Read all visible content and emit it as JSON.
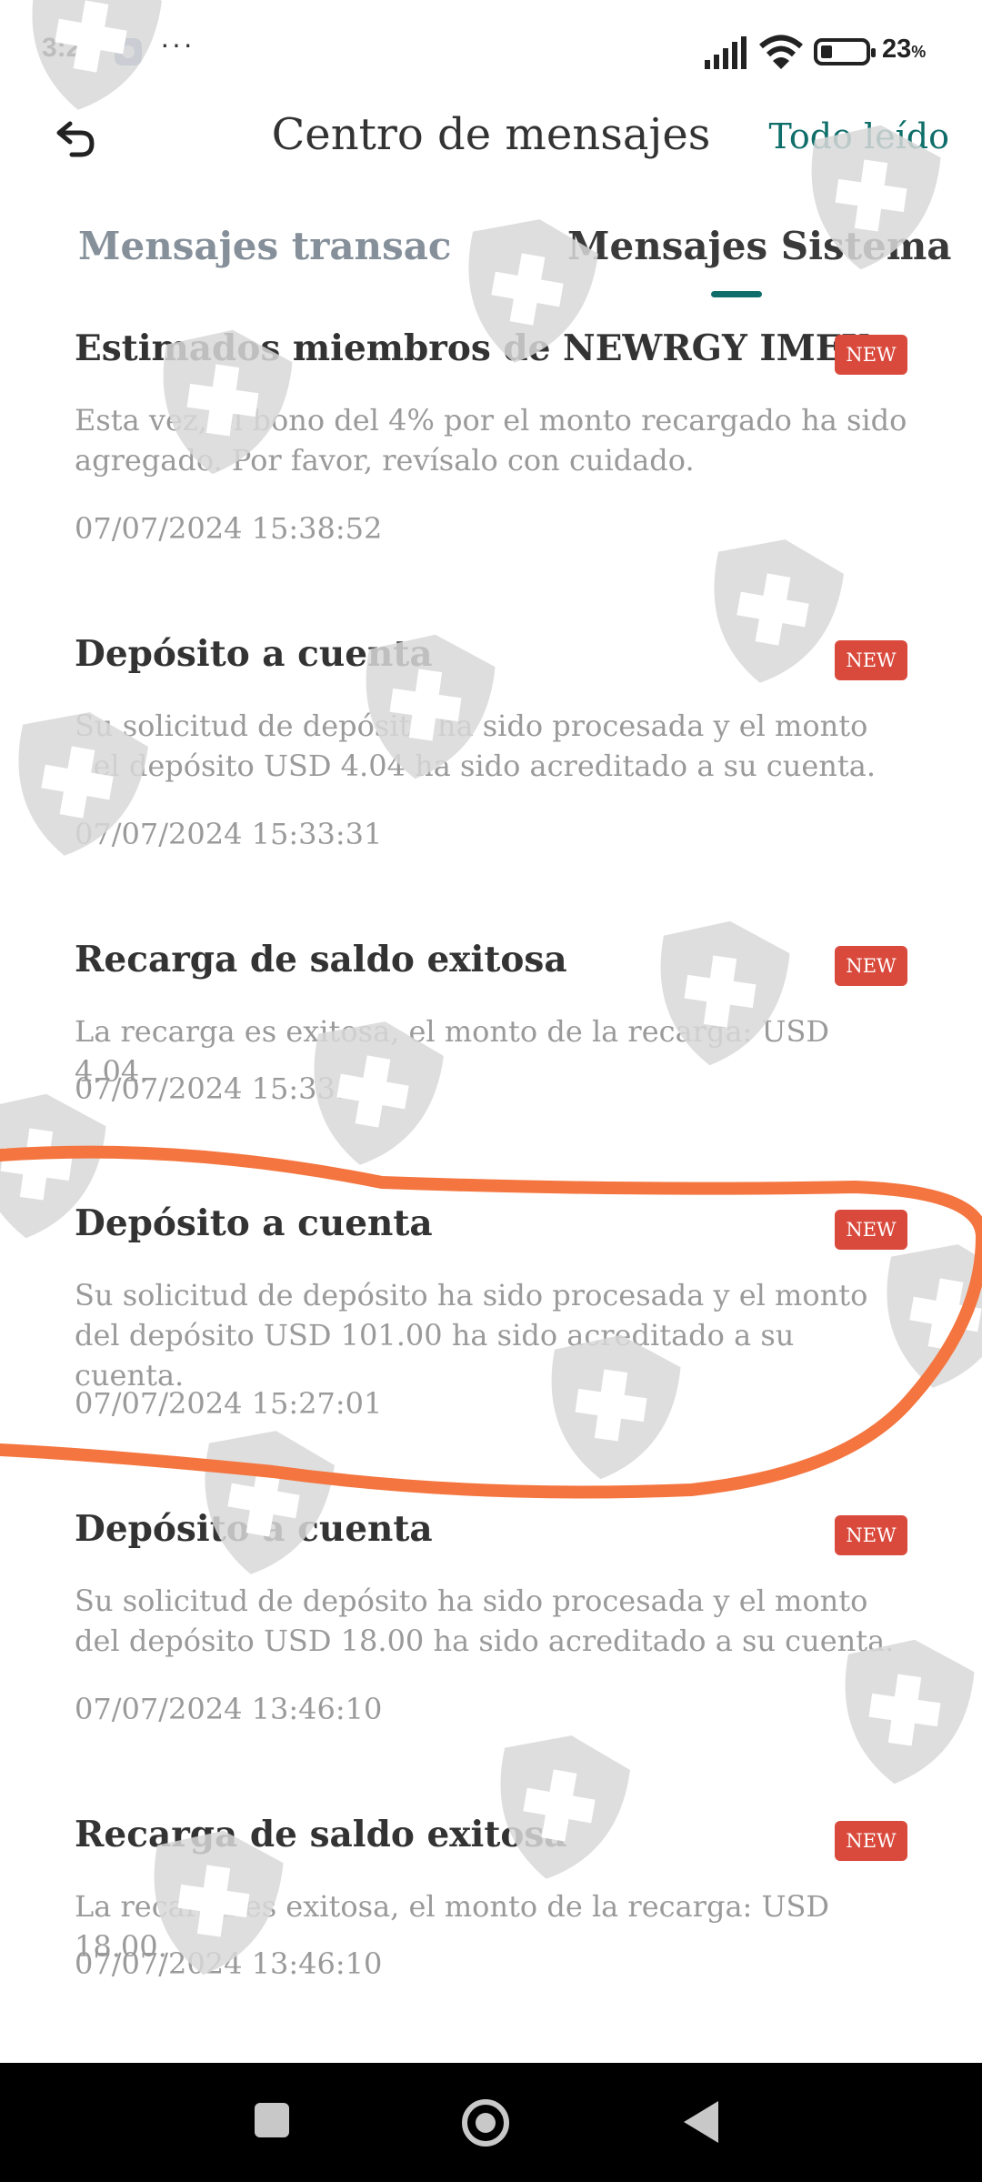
{
  "status_bar": {
    "time": "3:29",
    "more": "···",
    "battery_percent": "23",
    "battery_unit": "%"
  },
  "header": {
    "title": "Centro de mensajes",
    "read_all_label": "Todo leído",
    "back_icon": "undo-arrow-icon"
  },
  "tabs": [
    {
      "label": "Mensajes transac",
      "active": false
    },
    {
      "label": "Mensajes Sistema",
      "active": true
    }
  ],
  "badge_label": "NEW",
  "messages": [
    {
      "title": "Estimados miembros de NEWRGY IMEX:",
      "body": "Esta vez, el bono del 4% por el monto recargado ha sido agregado. Por favor, revísalo con cuidado.",
      "time": "07/07/2024 15:38:52"
    },
    {
      "title": "Depósito a cuenta",
      "body": "Su solicitud de depósito ha sido procesada y el monto del depósito USD 4.04 ha sido acreditado a su cuenta.",
      "time": "07/07/2024 15:33:31"
    },
    {
      "title": "Recarga de saldo exitosa",
      "body": "La recarga es exitosa, el monto de la recarga: USD 4.04.",
      "time": "07/07/2024 15:33:31"
    },
    {
      "title": "Depósito a cuenta",
      "body": "Su solicitud de depósito ha sido procesada y el monto del depósito USD 101.00 ha sido acreditado a su cuenta.",
      "time": "07/07/2024 15:27:01"
    },
    {
      "title": "Depósito a cuenta",
      "body": "Su solicitud de depósito ha sido procesada y el monto del depósito USD 18.00 ha sido acreditado a su cuenta.",
      "time": "07/07/2024 13:46:10"
    },
    {
      "title": "Recarga de saldo exitosa",
      "body": "La recarga es exitosa, el monto de la recarga: USD 18.00.",
      "time": "07/07/2024 13:46:10"
    }
  ],
  "colors": {
    "accent": "#0f6e6a",
    "badge": "#d94a3d",
    "annotation": "#f4753f",
    "watermark": "#e2e2e2"
  },
  "nav_bar": {
    "icons": [
      "recents-icon",
      "home-icon",
      "back-triangle-icon"
    ]
  }
}
